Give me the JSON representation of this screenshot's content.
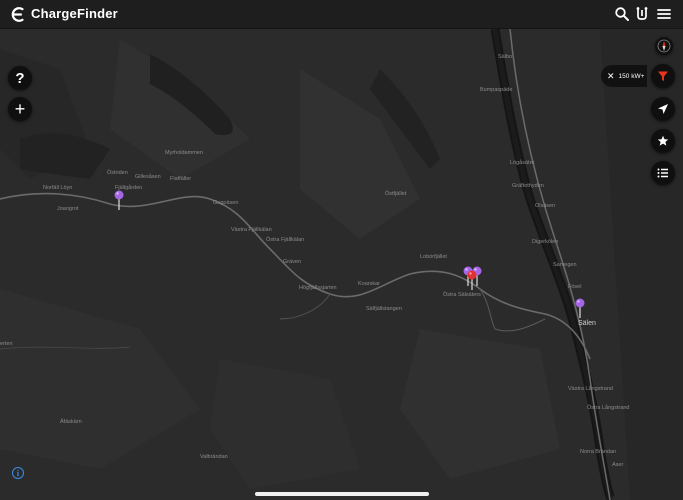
{
  "header": {
    "title": "ChargeFinder",
    "icons": [
      "search-icon",
      "route-icon",
      "menu-icon"
    ]
  },
  "left_controls": {
    "help_label": "?",
    "add_label": "+"
  },
  "filter_chip": {
    "label": "150 kW+",
    "close_label": "✕"
  },
  "right_controls": [
    "compass-icon",
    "filter-icon",
    "locate-icon",
    "favorites-icon",
    "list-icon"
  ],
  "colors": {
    "accent": "#e8341c",
    "pin_purple": "#a566e6",
    "pin_red": "#e03131",
    "map_bg": "#2b2b2b",
    "road": "#6b6b6b"
  },
  "map": {
    "places": [
      {
        "name": "Sälen",
        "kind": "town"
      },
      {
        "name": "Myrholdammen"
      },
      {
        "name": "Östriden"
      },
      {
        "name": "Gillesåsen"
      },
      {
        "name": "Flatfäller"
      },
      {
        "name": "Norfäll Löyn"
      },
      {
        "name": "Fjällgården"
      },
      {
        "name": "Joangrot"
      },
      {
        "name": "Gugoäsen"
      },
      {
        "name": "Västra Fjällkälan"
      },
      {
        "name": "Östra Fjällkälan"
      },
      {
        "name": "Gräven"
      },
      {
        "name": "Högfjällssjarten"
      },
      {
        "name": "Koarskar"
      },
      {
        "name": "Sälfjällstangen"
      },
      {
        "name": "Östra Sälsäters"
      },
      {
        "name": "Lobörfjället"
      },
      {
        "name": "Östfjället"
      },
      {
        "name": "Bumpaspäde"
      },
      {
        "name": "Sälbo"
      },
      {
        "name": "Lögåsätre"
      },
      {
        "name": "Gräftothyden"
      },
      {
        "name": "Olsäsen"
      },
      {
        "name": "Digerkölen"
      },
      {
        "name": "Sarvegen"
      },
      {
        "name": "Fösel"
      },
      {
        "name": "Västra Långstrand"
      },
      {
        "name": "Östra Långstrand"
      },
      {
        "name": "Norra Brändan"
      },
      {
        "name": "Aser"
      },
      {
        "name": "Valbrändan"
      },
      {
        "name": "Äfäskärn"
      },
      {
        "name": "erten"
      }
    ]
  }
}
